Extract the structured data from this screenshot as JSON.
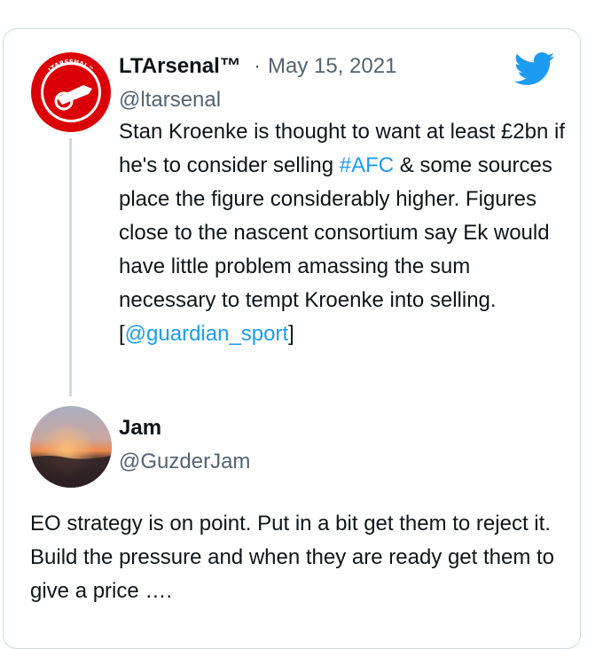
{
  "colors": {
    "text": "#0f1419",
    "secondary": "#536471",
    "link": "#1d9bf0",
    "border": "#cfd9de",
    "twitter_blue": "#1d9bf0",
    "brand_red": "#db0007"
  },
  "quoted_tweet": {
    "display_name": "LTArsenal™",
    "separator": "·",
    "date": "May 15, 2021",
    "handle": "@ltarsenal",
    "avatar_icon": "arsenal-cannon-logo",
    "avatar_text": "LTARSENAL™",
    "text_parts": {
      "p1": "Stan Kroenke is thought to want at least £2bn if he's to consider selling ",
      "hashtag": "#AFC",
      "p2": " & some sources place the figure considerably higher. Figures close to the nascent consortium say Ek would have little problem amassing the sum necessary to tempt Kroenke into selling. [",
      "mention": "@guardian_sport",
      "p3": "]"
    }
  },
  "reply": {
    "display_name": "Jam",
    "handle": "@GuzderJam",
    "avatar_icon": "sunset-photo-avatar",
    "text": "EO strategy is on point. Put in a bit get them to reject it. Build the pressure and when they are ready get them to give a price …."
  },
  "logo_icon": "twitter-bird-icon"
}
